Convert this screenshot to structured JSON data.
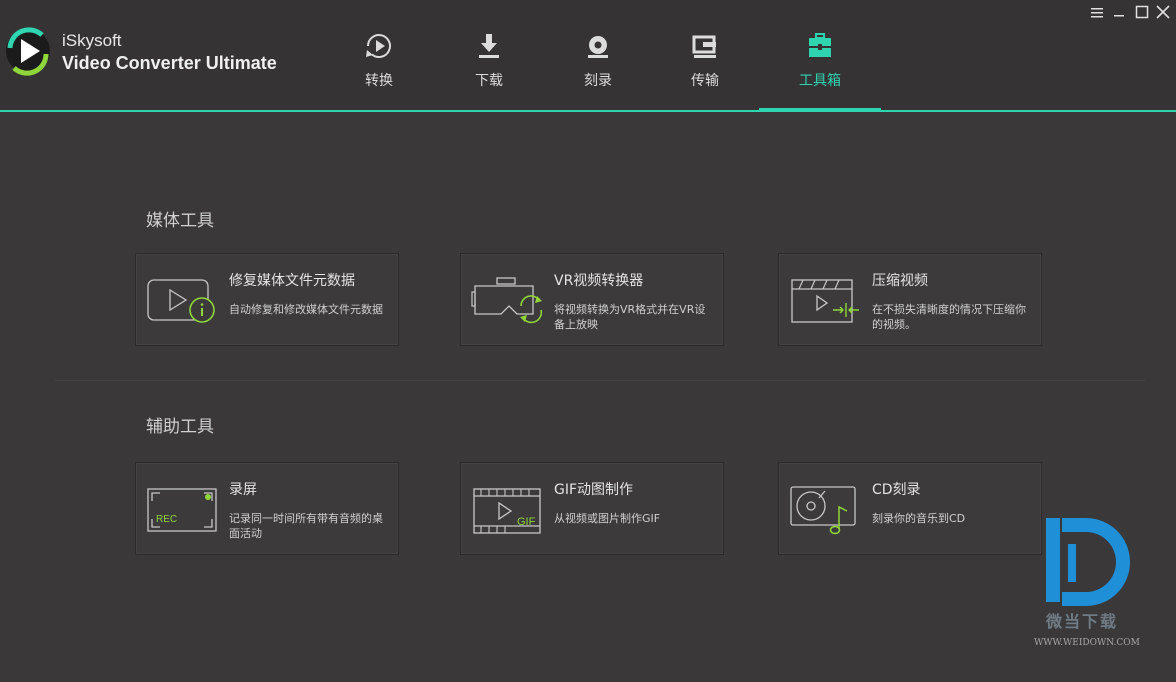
{
  "app": {
    "name_line1": "iSkysoft",
    "name_line2": "Video Converter Ultimate"
  },
  "tabs": [
    {
      "label": "转换",
      "icon": "convert-icon"
    },
    {
      "label": "下载",
      "icon": "download-icon"
    },
    {
      "label": "刻录",
      "icon": "burn-icon"
    },
    {
      "label": "传输",
      "icon": "transfer-icon"
    },
    {
      "label": "工具箱",
      "icon": "toolbox-icon",
      "active": true
    }
  ],
  "sections": {
    "media": {
      "title": "媒体工具",
      "cards": [
        {
          "title": "修复媒体文件元数据",
          "desc": "自动修复和修改媒体文件元数据",
          "icon": "metadata-icon"
        },
        {
          "title": "VR视频转换器",
          "desc": "将视频转换为VR格式并在VR设备上放映",
          "icon": "vr-icon"
        },
        {
          "title": "压缩视频",
          "desc": "在不损失清晰度的情况下压缩你的视频。",
          "icon": "compress-icon"
        }
      ]
    },
    "aux": {
      "title": "辅助工具",
      "cards": [
        {
          "title": "录屏",
          "desc": "记录同一时间所有带有音频的桌面活动",
          "icon": "record-screen-icon",
          "icon_text": "REC"
        },
        {
          "title": "GIF动图制作",
          "desc": "从视频或图片制作GIF",
          "icon": "gif-icon",
          "icon_text": "GIF"
        },
        {
          "title": "CD刻录",
          "desc": "刻录你的音乐到CD",
          "icon": "cd-burn-icon"
        }
      ]
    }
  },
  "watermark": {
    "line1": "微当下载",
    "line2": "WWW.WEIDOWN.COM"
  },
  "colors": {
    "accent": "#2fd4b0",
    "icon_green": "#8fd63a",
    "background": "#3a3839",
    "header": "#353334"
  }
}
